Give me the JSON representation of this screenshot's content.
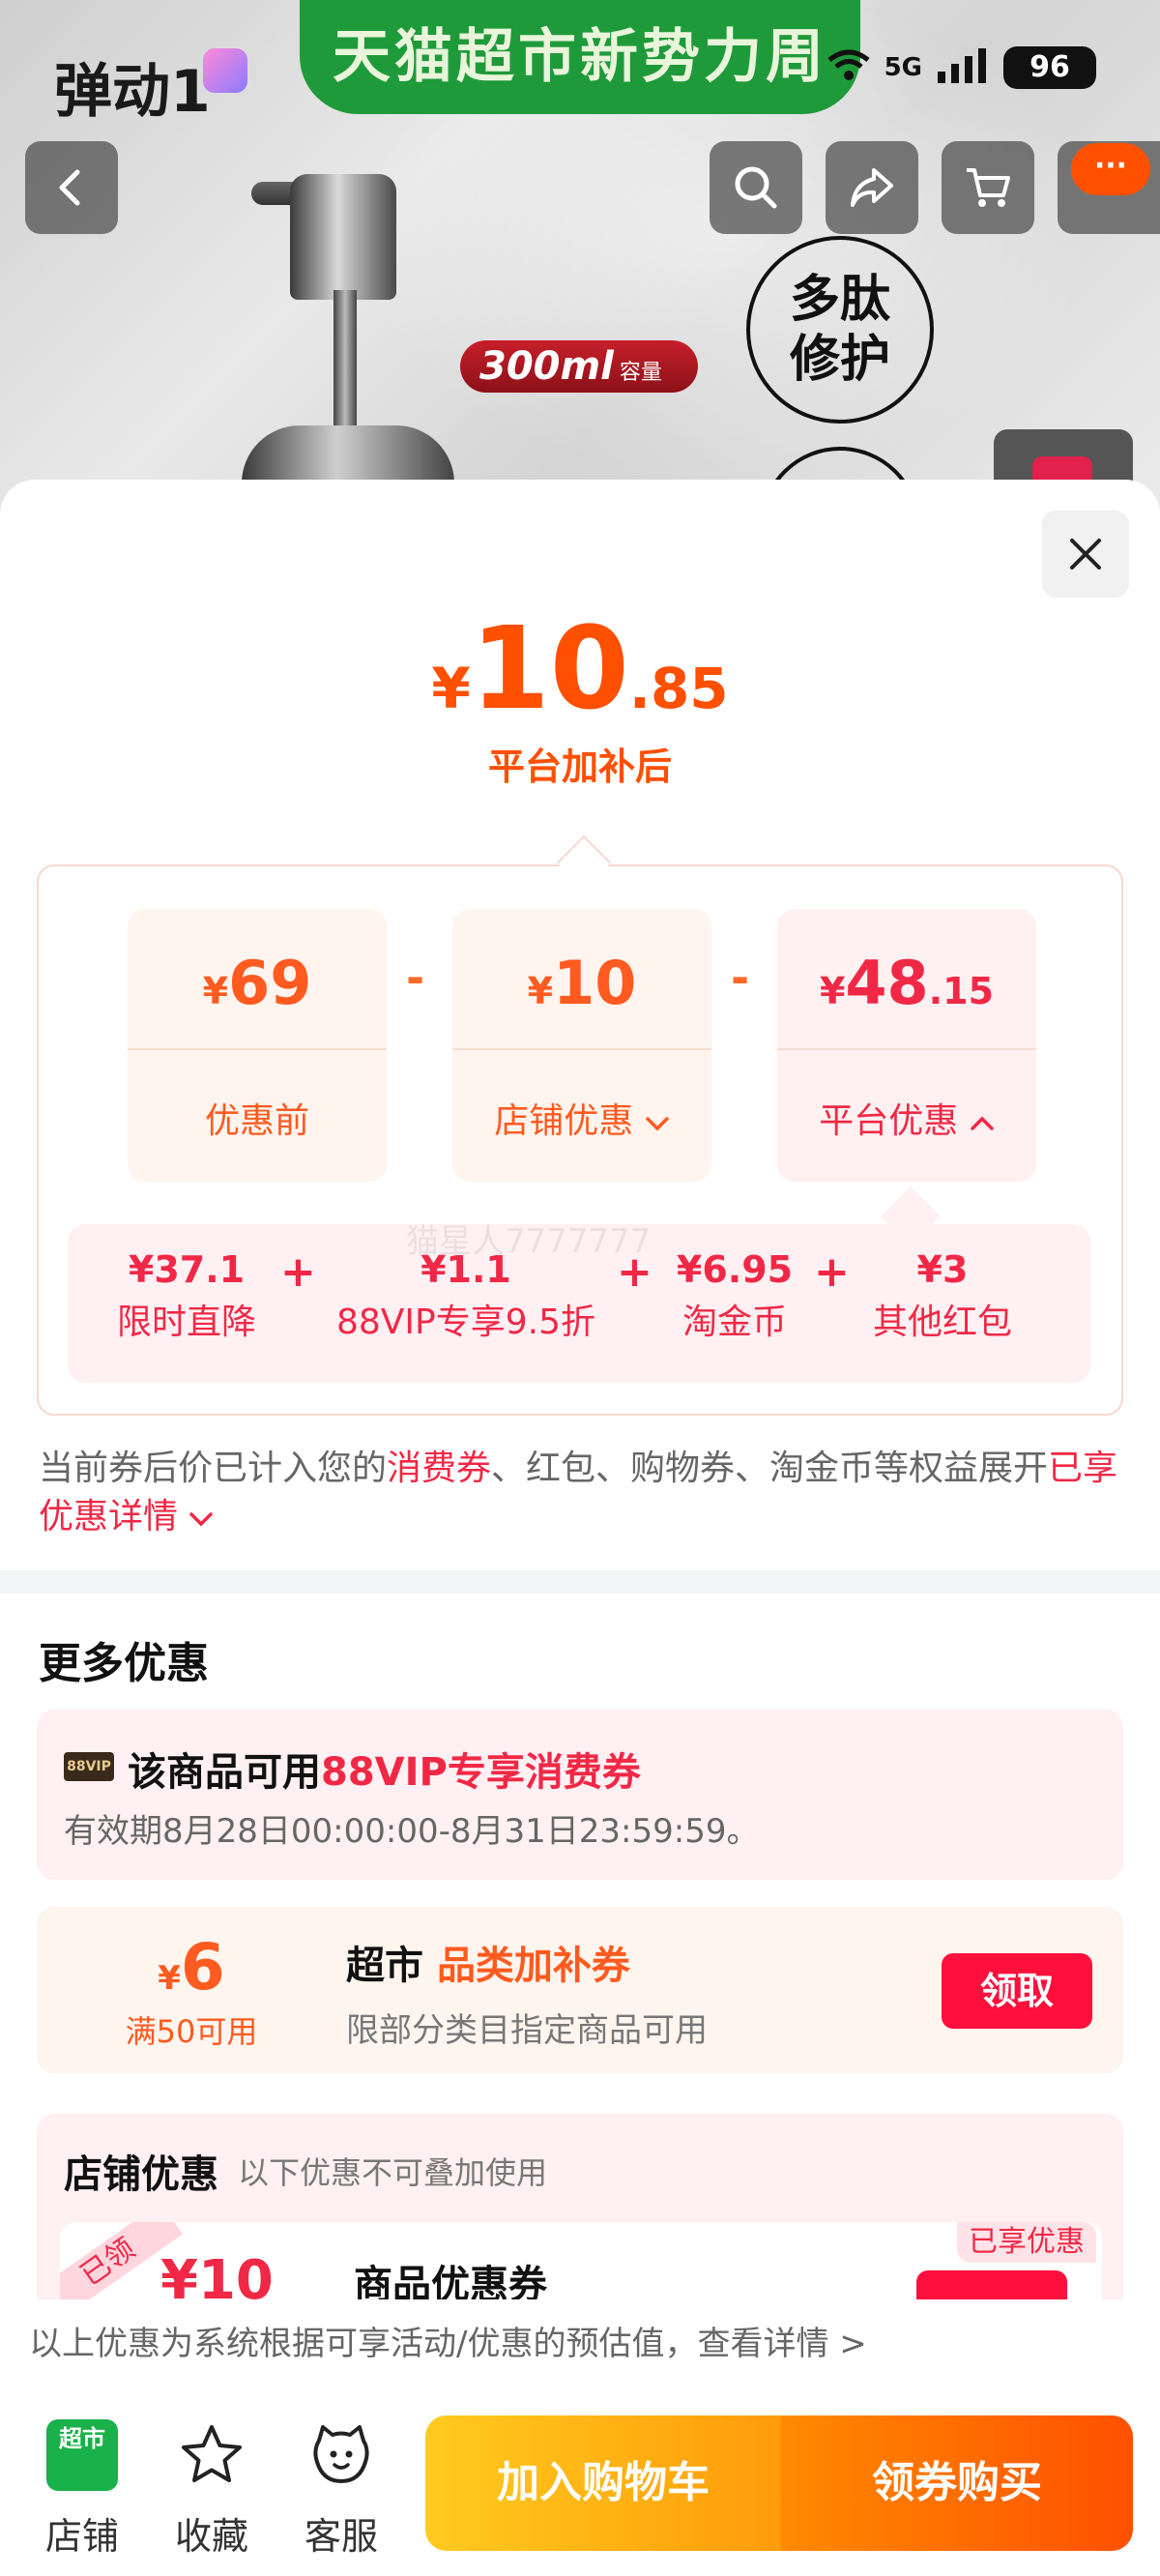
{
  "status_bar": {
    "brand_text": "弹动1",
    "signal": "5G",
    "battery": "96"
  },
  "banner": {
    "text": "天猫超市新势力周"
  },
  "product_bg": {
    "capacity": "300ml",
    "capacity_unit": "容量",
    "feature_line1": "多肽",
    "feature_line2": "修护"
  },
  "price": {
    "currency": "¥",
    "integer": "10",
    "decimal": ".85",
    "label": "平台加补后"
  },
  "calc": {
    "before": {
      "currency": "¥",
      "integer": "69",
      "decimal": "",
      "label": "优惠前"
    },
    "store": {
      "currency": "¥",
      "integer": "10",
      "decimal": "",
      "label": "店铺优惠"
    },
    "platform": {
      "currency": "¥",
      "integer": "48",
      "decimal": ".15",
      "label": "平台优惠"
    },
    "minus": "-"
  },
  "breakdown": {
    "items": [
      {
        "value": "¥37.1",
        "label": "限时直降"
      },
      {
        "value": "¥1.1",
        "label": "88VIP专享9.5折"
      },
      {
        "value": "¥6.95",
        "label": "淘金币"
      },
      {
        "value": "¥3",
        "label": "其他红包"
      }
    ],
    "plus": "+",
    "watermark": "猫星人7777777"
  },
  "note": {
    "prefix": "当前券后价已计入您的",
    "consumer_coupon": "消费券",
    "middle": "、红包、购物券、淘金币等权益展开",
    "details_link": "已享优惠详情"
  },
  "more": {
    "title": "更多优惠",
    "vip": {
      "tag": "88VIP",
      "prefix": "该商品可用",
      "highlight": "88VIP专享消费券",
      "validity": "有效期8月28日00:00:00-8月31日23:59:59。"
    },
    "coupon": {
      "currency": "¥",
      "amount": "6",
      "condition": "满50可用",
      "title_prefix": "超市",
      "title_highlight": "品类加补券",
      "desc": "限部分类目指定商品可用",
      "button": "领取"
    }
  },
  "store_discount": {
    "title": "店铺优惠",
    "subtitle": "以下优惠不可叠加使用",
    "claimed": "已领",
    "amount": "¥10",
    "coupon_name": "商品优惠券",
    "enjoyed": "已享优惠"
  },
  "disclaimer": "以上优惠为系统根据可享活动/优惠的预估值，查看详情 >",
  "bottom": {
    "store_logo_text": "超市",
    "store": "店铺",
    "favorite": "收藏",
    "service": "客服",
    "add_to_cart": "加入购物车",
    "buy": "领券购买"
  },
  "colors": {
    "accent_orange": "#ff4f00",
    "accent_red": "#f02846",
    "tmall_green": "#1f9a3a"
  }
}
